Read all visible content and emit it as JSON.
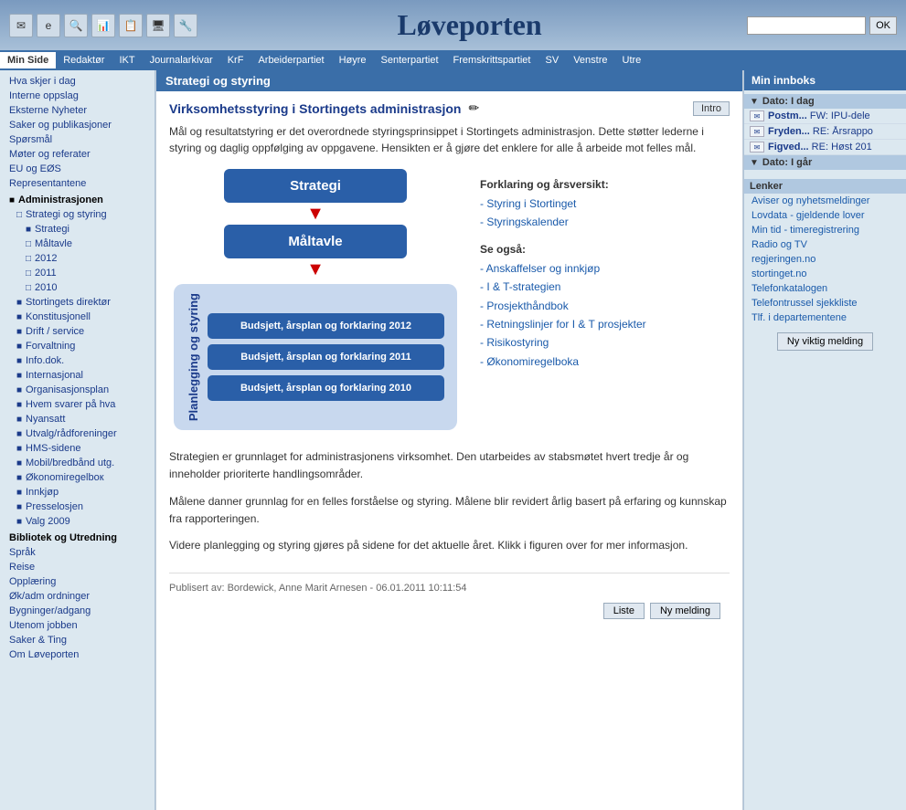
{
  "header": {
    "title": "Løveporten",
    "search_placeholder": "",
    "search_btn": "OK",
    "icons": [
      "✉",
      "🌐",
      "🔍",
      "📊",
      "📋",
      "🖥",
      "🔧"
    ]
  },
  "navbar": {
    "items": [
      {
        "label": "Min Side",
        "active": true
      },
      {
        "label": "Redaktør",
        "active": false
      },
      {
        "label": "IKT",
        "active": false
      },
      {
        "label": "Journalarkivar",
        "active": false
      },
      {
        "label": "KrF",
        "active": false
      },
      {
        "label": "Arbeiderpartiet",
        "active": false
      },
      {
        "label": "Høyre",
        "active": false
      },
      {
        "label": "Senterpartiet",
        "active": false
      },
      {
        "label": "Fremskrittspartiet",
        "active": false
      },
      {
        "label": "SV",
        "active": false
      },
      {
        "label": "Venstre",
        "active": false
      },
      {
        "label": "Utre",
        "active": false
      }
    ]
  },
  "sidebar": {
    "items": [
      {
        "label": "Hva skjer i dag",
        "level": 0,
        "toggle": ""
      },
      {
        "label": "Interne oppslag",
        "level": 0,
        "toggle": ""
      },
      {
        "label": "Eksterne Nyheter",
        "level": 0,
        "toggle": ""
      },
      {
        "label": "Saker og publikasjoner",
        "level": 0,
        "toggle": ""
      },
      {
        "label": "Spørsmål",
        "level": 0,
        "toggle": ""
      },
      {
        "label": "Møter og referater",
        "level": 0,
        "toggle": ""
      },
      {
        "label": "EU og EØS",
        "level": 0,
        "toggle": ""
      },
      {
        "label": "Representantene",
        "level": 0,
        "toggle": ""
      },
      {
        "label": "Administrasjonen",
        "level": 0,
        "toggle": "■",
        "section": true
      },
      {
        "label": "Strategi og styring",
        "level": 1,
        "toggle": "□"
      },
      {
        "label": "Strategi",
        "level": 2,
        "toggle": "■"
      },
      {
        "label": "Måltavle",
        "level": 2,
        "toggle": "□"
      },
      {
        "label": "2012",
        "level": 2,
        "toggle": "□"
      },
      {
        "label": "2011",
        "level": 2,
        "toggle": "□"
      },
      {
        "label": "2010",
        "level": 2,
        "toggle": "□"
      },
      {
        "label": "Stortingets direktør",
        "level": 1,
        "toggle": "■"
      },
      {
        "label": "Konstitusjonell",
        "level": 1,
        "toggle": "■"
      },
      {
        "label": "Drift / service",
        "level": 1,
        "toggle": "■"
      },
      {
        "label": "Forvaltning",
        "level": 1,
        "toggle": "■"
      },
      {
        "label": "Info.dok.",
        "level": 1,
        "toggle": "■"
      },
      {
        "label": "Internasjonal",
        "level": 1,
        "toggle": "■"
      },
      {
        "label": "Organisasjonsplan",
        "level": 1,
        "toggle": "■"
      },
      {
        "label": "Hvem svarer på hva",
        "level": 1,
        "toggle": "■"
      },
      {
        "label": "Nyansatt",
        "level": 1,
        "toggle": "■"
      },
      {
        "label": "Utvalg/rådforeninger",
        "level": 1,
        "toggle": "■"
      },
      {
        "label": "HMS-sidene",
        "level": 1,
        "toggle": "■"
      },
      {
        "label": "Mobil/bredbånd utg.",
        "level": 1,
        "toggle": "■"
      },
      {
        "label": "Økonomiregelbок",
        "level": 1,
        "toggle": "■"
      },
      {
        "label": "Innkjøp",
        "level": 1,
        "toggle": "■"
      },
      {
        "label": "Presselosjen",
        "level": 1,
        "toggle": "■"
      },
      {
        "label": "Valg 2009",
        "level": 1,
        "toggle": "■"
      },
      {
        "label": "Bibliotek og Utredning",
        "level": 0,
        "toggle": "",
        "section": true
      },
      {
        "label": "Språk",
        "level": 0,
        "toggle": ""
      },
      {
        "label": "Reise",
        "level": 0,
        "toggle": ""
      },
      {
        "label": "Opplæring",
        "level": 0,
        "toggle": ""
      },
      {
        "label": "Øk/adm ordninger",
        "level": 0,
        "toggle": ""
      },
      {
        "label": "Bygninger/adgang",
        "level": 0,
        "toggle": ""
      },
      {
        "label": "Utenom jobben",
        "level": 0,
        "toggle": ""
      },
      {
        "label": "Saker & Ting",
        "level": 0,
        "toggle": ""
      },
      {
        "label": "Om Løveporten",
        "level": 0,
        "toggle": ""
      }
    ]
  },
  "main": {
    "header": "Strategi og styring",
    "page_title": "Virksomhetsstyring i Stortingets administrasjon",
    "edit_icon": "✏",
    "intro_btn": "Intro",
    "intro_text": "Mål og resultatstyring er det overordnede styringsprinsippet i Stortingets administrasjon. Dette støtter lederne i styring og daglig oppfølging av oppgavene. Hensikten er å gjøre det enklere for alle å arbeide mot felles mål.",
    "diagram": {
      "strategi_label": "Strategi",
      "maaltavle_label": "Måltavle",
      "planning_label": "Planlegging og styring",
      "boxes": [
        "Budsjett, årsplan og forklaring 2012",
        "Budsjett, årsplan og forklaring 2011",
        "Budsjett, årsplan og forklaring 2010"
      ]
    },
    "side_info": {
      "forklaring_title": "Forklaring og årsversikt:",
      "links1": [
        {
          "text": "Styring i Stortinget",
          "href": "#"
        },
        {
          "text": "Styringskalender",
          "href": "#"
        }
      ],
      "se_ogsaa_title": "Se også:",
      "links2": [
        {
          "text": "Anskaffelser og innkjøp",
          "href": "#"
        },
        {
          "text": "I & T-strategien",
          "href": "#"
        },
        {
          "text": "Prosjekthåndbok",
          "href": "#"
        },
        {
          "text": "Retningslinjer for I & T prosjekter",
          "href": "#"
        },
        {
          "text": "Risikostyring",
          "href": "#"
        },
        {
          "text": "Økonomiregelboka",
          "href": "#"
        }
      ]
    },
    "bottom_paragraphs": [
      "Strategien er grunnlaget for administrasjonens virksomhet. Den utarbeides av stabsmøtet hvert tredje år og inneholder prioriterte handlingsområder.",
      "Målene danner grunnlag for en felles forståelse og styring. Målene blir revidert årlig basert på erfaring og kunnskap fra rapporteringen.",
      "Videre planlegging og styring gjøres på sidene for det aktuelle året. Klikk i figuren over for mer informasjon."
    ],
    "published": "Publisert av: Bordewick, Anne Marit Arnesen - 06.01.2011 10:11:54",
    "bottom_buttons": [
      "Liste",
      "Ny melding"
    ]
  },
  "right_sidebar": {
    "title": "Min innboks",
    "sections": [
      {
        "date_label": "Dato: I dag",
        "items": [
          {
            "icon": "✉",
            "label": "Postm...",
            "preview": "FW: IPU-dele"
          },
          {
            "icon": "✉",
            "label": "Fryden...",
            "preview": "RE: Årsrappo"
          },
          {
            "icon": "✉",
            "label": "Figved...",
            "preview": "RE: Høst 201"
          }
        ]
      },
      {
        "date_label": "Dato: I går",
        "items": []
      }
    ],
    "links_title": "Lenker",
    "links": [
      "Aviser og nyhetsmeldinger",
      "Lovdata - gjeldende lover",
      "Min tid - timeregistrering",
      "Radio og TV",
      "regjeringen.no",
      "stortinget.no",
      "Telefonkatalogen",
      "Telefontrussel sjekkliste",
      "Tlf. i departementene"
    ],
    "new_message_btn": "Ny viktig melding"
  }
}
